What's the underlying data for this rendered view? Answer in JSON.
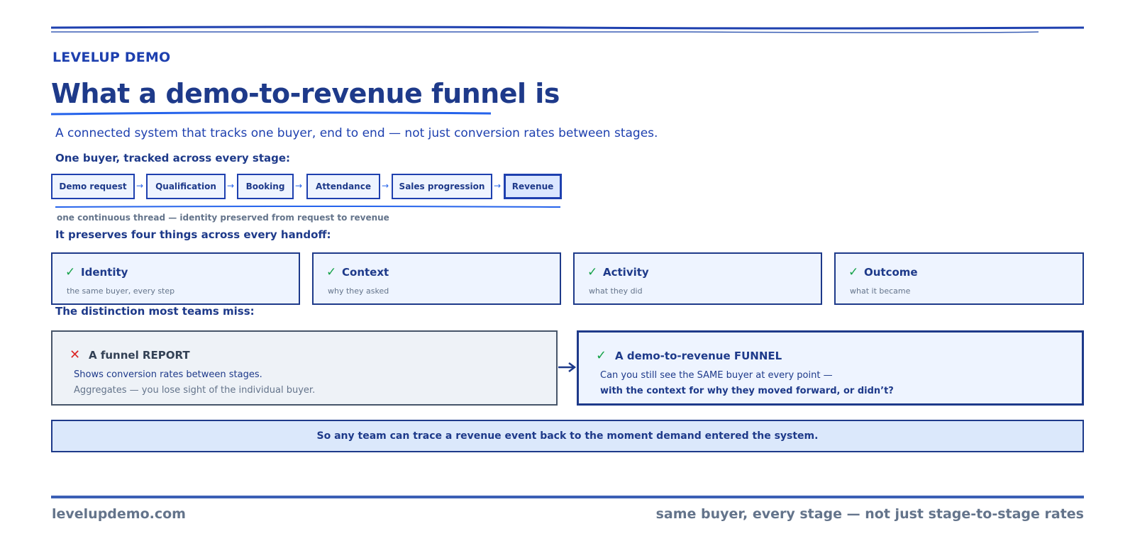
{
  "brand": "LEVELUP DEMO",
  "title": "What a demo-to-revenue funnel is",
  "subtitle": "A connected system that tracks one buyer, end to end — not just conversion rates between stages.",
  "stages_label": "One buyer, tracked across every stage:",
  "stages": [
    "Demo request",
    "Qualification",
    "Booking",
    "Attendance",
    "Sales progression",
    "Revenue"
  ],
  "thread_note": "one continuous thread — identity preserved from request to revenue",
  "preserves_label": "It preserves four things across every handoff:",
  "preserves": [
    {
      "name": "Identity",
      "desc": "the same buyer, every step"
    },
    {
      "name": "Context",
      "desc": "why they asked"
    },
    {
      "name": "Activity",
      "desc": "what they did"
    },
    {
      "name": "Outcome",
      "desc": "what it became"
    }
  ],
  "distinction_label": "The distinction most teams miss:",
  "report": {
    "icon": "cross-icon",
    "title": "A funnel REPORT",
    "line1": "Shows conversion rates between stages.",
    "line2": "Aggregates — you lose sight of the individual buyer."
  },
  "funnel": {
    "icon": "check-icon",
    "title": "A demo-to-revenue FUNNEL",
    "line1": "Can you still see the SAME buyer at every point —",
    "line2": "with the context for why they moved forward, or didn’t?"
  },
  "banner": "So any team can trace a revenue event back to the moment demand entered the system.",
  "footer": {
    "left": "levelupdemo.com",
    "right": "same buyer, every stage — not just stage-to-stage rates"
  },
  "colors": {
    "primary": "#1e3a8a",
    "accent": "#2563eb",
    "check": "#16a34a",
    "cross": "#dc2626",
    "muted": "#64748b"
  }
}
